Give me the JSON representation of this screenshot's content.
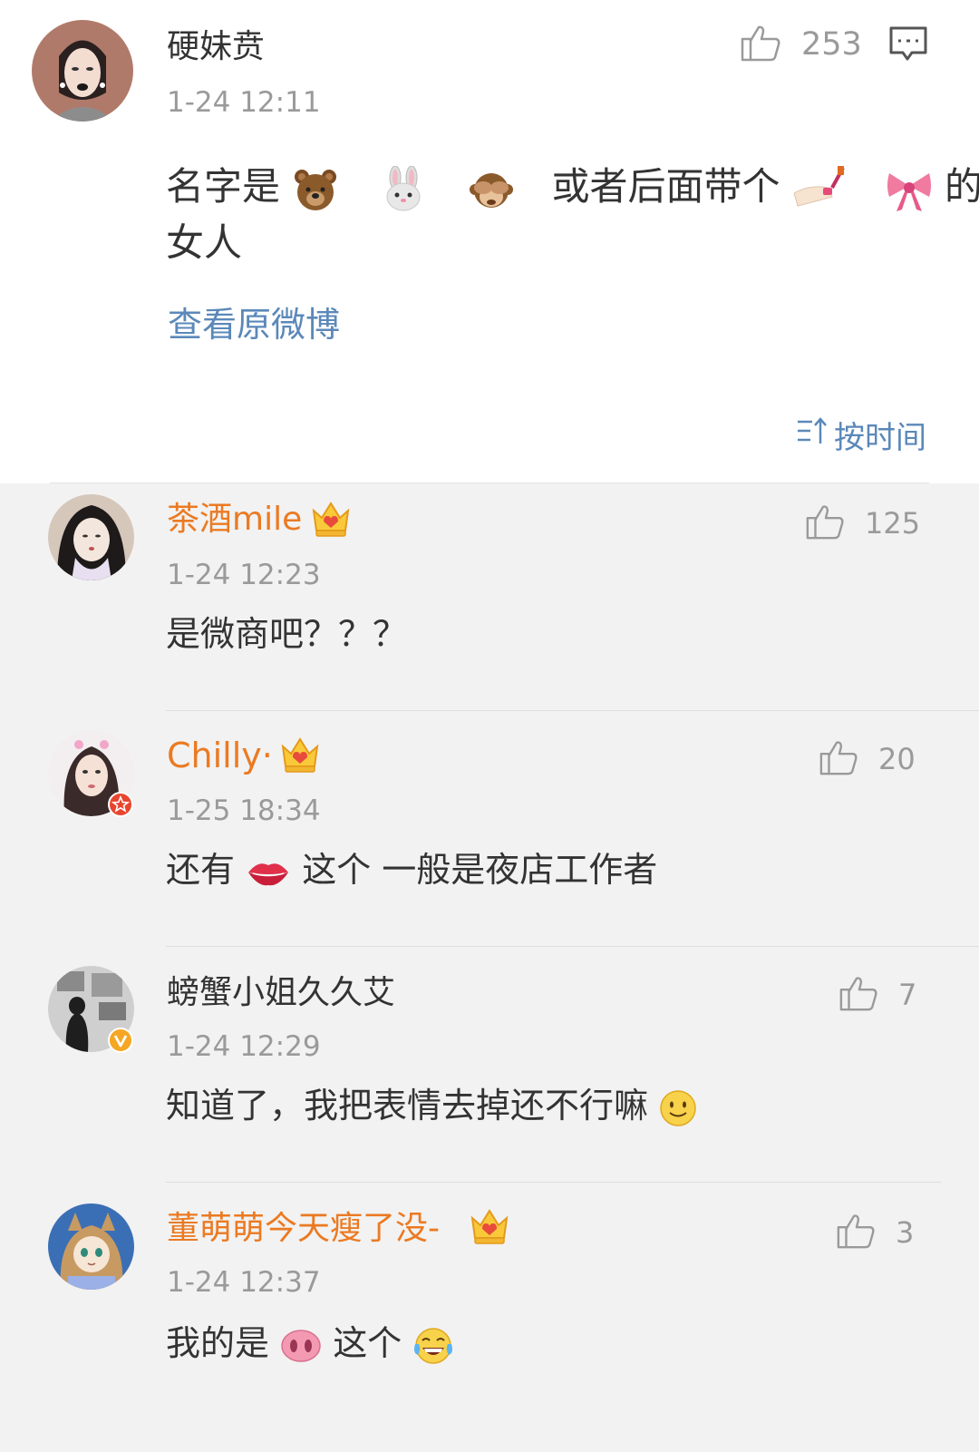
{
  "post": {
    "author": "硬妹贲",
    "time": "1-24 12:11",
    "like_count": "253",
    "text_line1_part1": "名字是",
    "text_line1_part2": "或者后面带个",
    "text_line1_part3": "的",
    "text_line2": "女人",
    "view_original": "查看原微博",
    "emoji_icons": [
      "bear-emoji-icon",
      "rabbit-emoji-icon",
      "see-no-evil-monkey-emoji-icon",
      "nail-polish-emoji-icon",
      "ribbon-bow-emoji-icon"
    ]
  },
  "sort": {
    "label": "按时间",
    "icon": "sort-icon"
  },
  "comments": [
    {
      "name": "茶酒mile",
      "name_color": "#eb7a22",
      "badge": "crown-vip-icon",
      "time": "1-24 12:23",
      "likes": "125",
      "text": "是微商吧？？？"
    },
    {
      "name": "Chilly·",
      "name_color": "#eb7a22",
      "badge": "crown-vip-icon",
      "time": "1-25 18:34",
      "likes": "20",
      "text_part1": "还有",
      "text_part2": "这个 一般是夜店工作者",
      "emoji_icons": [
        "lips-emoji-icon"
      ]
    },
    {
      "name": "螃蟹小姐久久艾",
      "name_color": "#333333",
      "badge": "verified-v-icon",
      "time": "1-24 12:29",
      "likes": "7",
      "text": "知道了，我把表情去掉还不行嘛",
      "emoji_icons": [
        "smile-emoji-icon"
      ]
    },
    {
      "name": "董萌萌今天瘦了没-",
      "name_color": "#eb7a22",
      "badge": "crown-vip-icon",
      "time": "1-24 12:37",
      "likes": "3",
      "text_part1": "我的是",
      "text_part2": "这个",
      "emoji_icons": [
        "pig-nose-emoji-icon",
        "laugh-tears-emoji-icon"
      ]
    }
  ],
  "colors": {
    "link_blue": "#5b88b9",
    "name_orange": "#eb7a22",
    "meta_gray": "#9a9a9a",
    "comment_bg": "#f2f2f2",
    "post_bg": "#ffffff"
  }
}
